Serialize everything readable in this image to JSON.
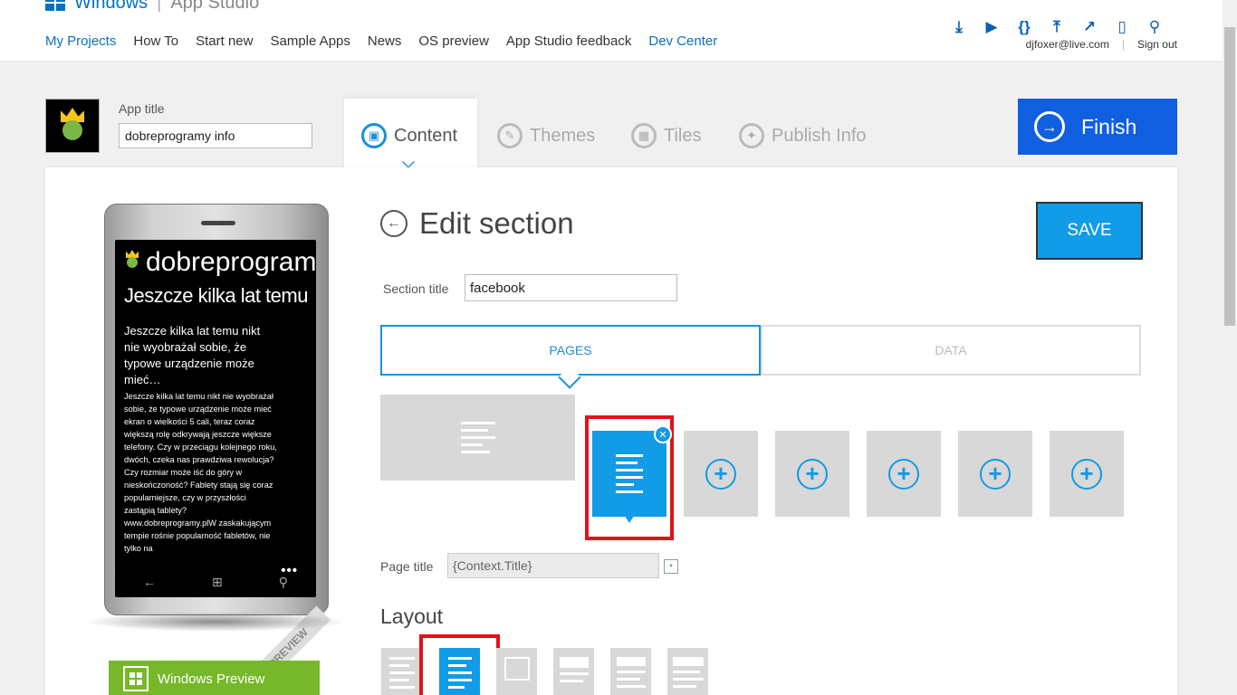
{
  "brand": {
    "name": "Windows",
    "product": "App Studio"
  },
  "nav": [
    "My Projects",
    "How To",
    "Start new",
    "Sample Apps",
    "News",
    "OS preview",
    "App Studio feedback",
    "Dev Center"
  ],
  "user": {
    "email": "djfoxer@live.com",
    "signout": "Sign out"
  },
  "app": {
    "title_label": "App title",
    "title_value": "dobreprogramy info"
  },
  "tabs": {
    "content": "Content",
    "themes": "Themes",
    "tiles": "Tiles",
    "publish": "Publish Info"
  },
  "finish_label": "Finish",
  "phone": {
    "app_name": "dobreprogramy info",
    "title": "Jeszcze kilka lat temu",
    "summary": "Jeszcze kilka lat temu nikt nie wyobrażał sobie, że typowe urządzenie może mieć…",
    "body": "Jeszcze kilka lat temu nikt nie wyobrażał sobie, że typowe urządzenie może mieć ekran o wielkości 5 cali, teraz coraz większą rolę odkrywają jeszcze większe telefony. Czy w przeciągu kolejnego roku, dwóch, czeka nas prawdziwa rewolucja? Czy rozmiar może iść do góry w nieskończoność? Fablety stają się coraz popularniejsze, czy w przyszłości zastąpią tablety? www.dobreprogramy.plW zaskakującym tempie rośnie popularność fabletów, nie tylko na",
    "dots": "•••",
    "ribbon": "PREVIEW"
  },
  "windows_preview": "Windows Preview",
  "edit": {
    "heading": "Edit section",
    "save": "SAVE",
    "section_title_label": "Section title",
    "section_title_value": "facebook",
    "subtab_pages": "PAGES",
    "subtab_data": "DATA",
    "page_title_label": "Page title",
    "page_title_value": "{Context.Title}",
    "layout_heading": "Layout"
  },
  "colors": {
    "accent": "#129be6",
    "finish": "#0f5fe0",
    "highlight": "#e0121a",
    "preview_green": "#76b82a"
  }
}
